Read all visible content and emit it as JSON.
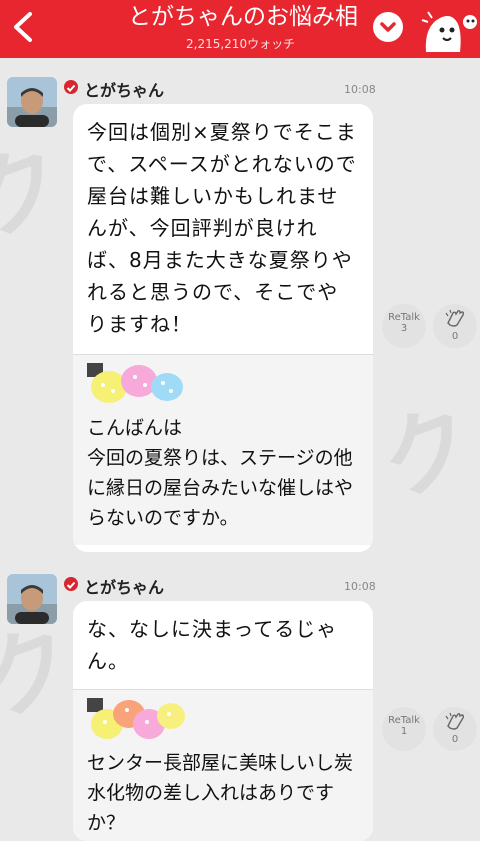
{
  "header": {
    "title": "とがちゃんのお悩み相",
    "watch_count": "2,215,210ウォッチ"
  },
  "messages": [
    {
      "sender": "とがちゃん",
      "time": "10:08",
      "reply": "今回は個別×夏祭りでそこまで、スペースがとれないので屋台は難しいかもしれませんが、今回評判が良ければ、8月また大きな夏祭りやれると思うので、そこでやりますね！",
      "quote": "こんばんは\n今回の夏祭りは、ステージの他に縁日の屋台みたいな催しはやらないのですか。",
      "retalk_label": "ReTalk",
      "retalk_count": "3",
      "clap_count": "0"
    },
    {
      "sender": "とがちゃん",
      "time": "10:08",
      "reply": "な、なしに決まってるじゃん。",
      "quote": "センター長部屋に美味しいし炭水化物の差し入れはありですか？",
      "retalk_label": "ReTalk",
      "retalk_count": "1",
      "clap_count": "0"
    }
  ],
  "colors": {
    "brand": "#e8262f",
    "background": "#e9e9e9"
  },
  "icons": [
    "back-arrow-icon",
    "chevron-down-icon",
    "mascot-icon",
    "verified-badge-icon",
    "clap-icon",
    "sticker-icon"
  ]
}
